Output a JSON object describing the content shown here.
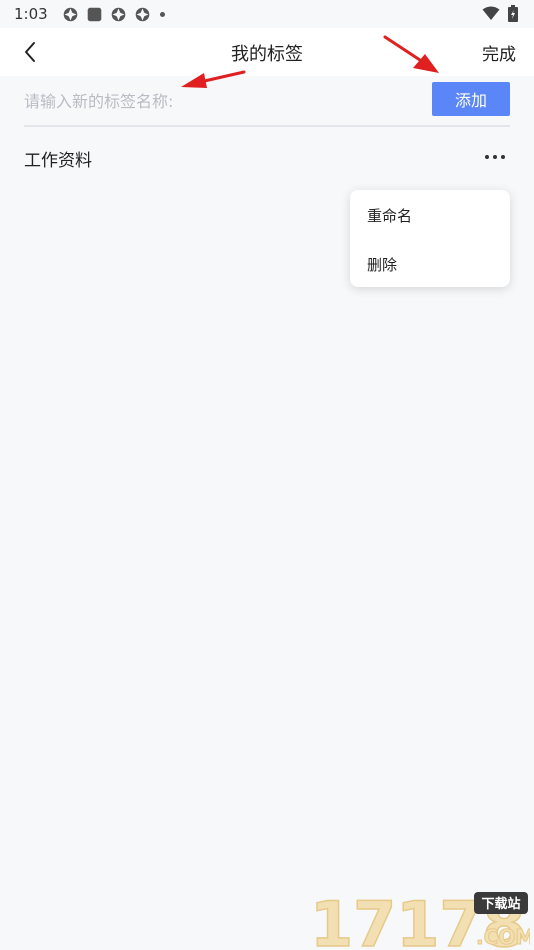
{
  "status": {
    "time": "1:03"
  },
  "header": {
    "title": "我的标签",
    "done_label": "完成"
  },
  "tag_input": {
    "placeholder": "请输入新的标签名称:",
    "value": ""
  },
  "add_button": {
    "label": "添加"
  },
  "tags": [
    {
      "name": "工作资料"
    }
  ],
  "context_menu": {
    "items": [
      {
        "label": "重命名"
      },
      {
        "label": "删除"
      }
    ]
  },
  "watermark": {
    "number": "17178",
    "badge": "下载站",
    "domain": ".COM"
  },
  "colors": {
    "accent": "#5b86f7",
    "background": "#f7f8fa",
    "annotation_arrow": "#e02020"
  }
}
